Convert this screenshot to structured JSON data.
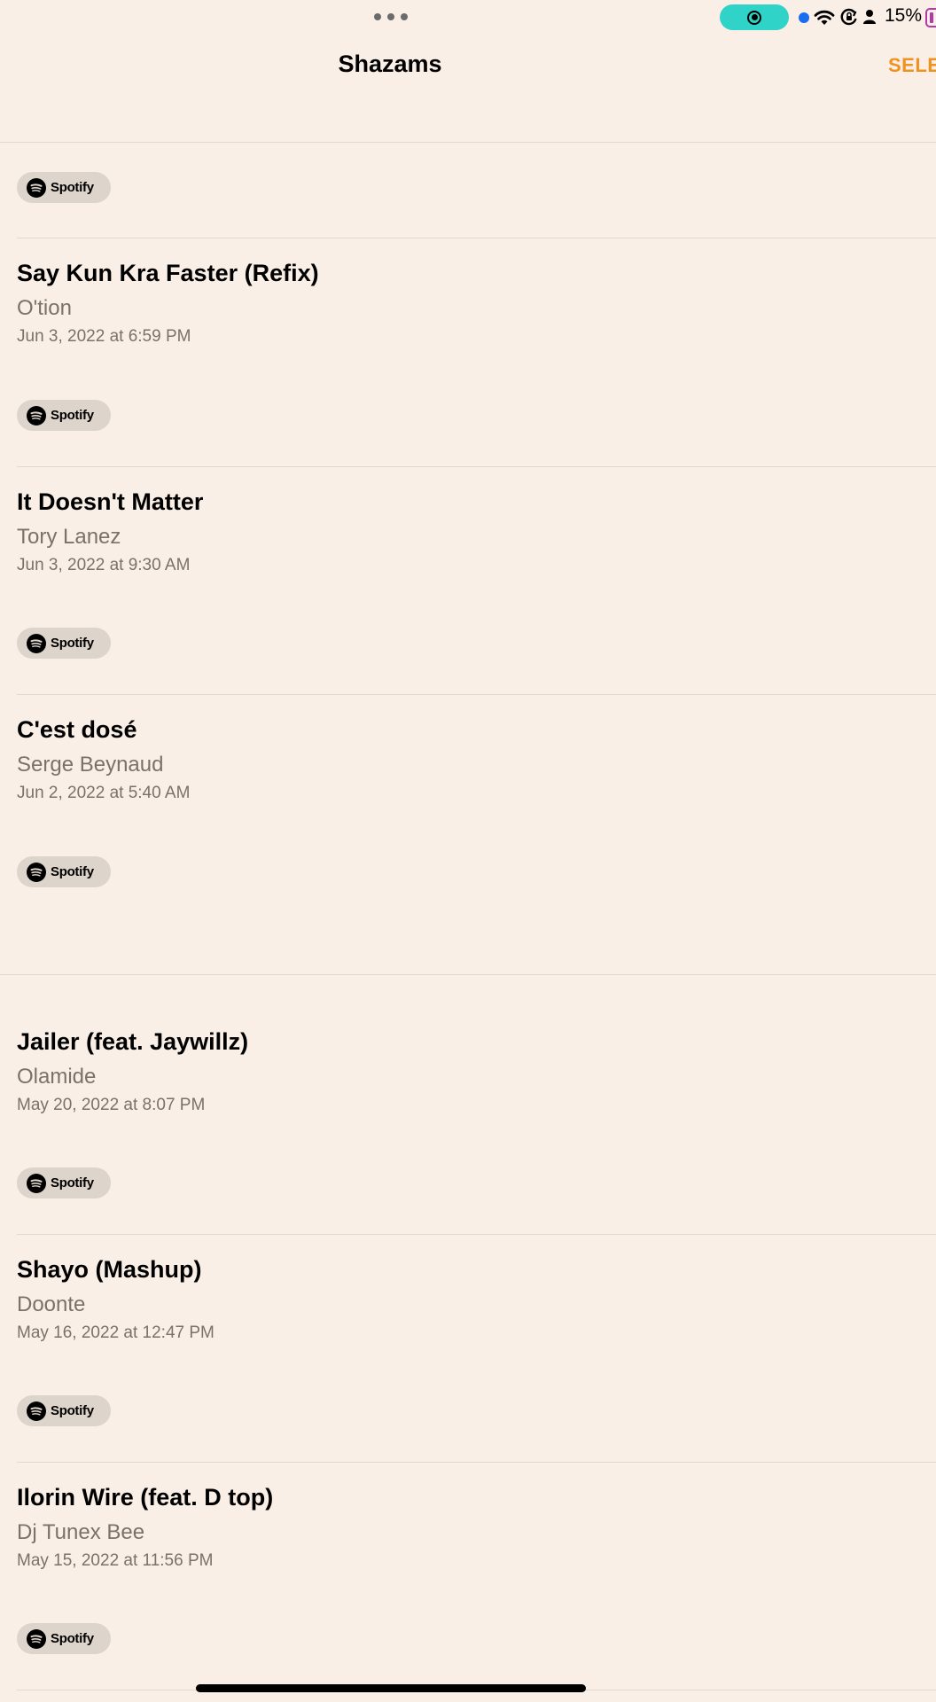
{
  "nav": {
    "title": "Shazams",
    "select_label": "SELE"
  },
  "status_bar": {
    "battery": "15%"
  },
  "spotify_label": "Spotify",
  "items": [
    {
      "title": "Say Kun Kra Faster (Refix)",
      "artist": "O'tion",
      "date": "Jun 3, 2022 at 6:59 PM"
    },
    {
      "title": "It Doesn't Matter",
      "artist": "Tory Lanez",
      "date": "Jun 3, 2022 at 9:30 AM"
    },
    {
      "title": "C'est dosé",
      "artist": "Serge Beynaud",
      "date": "Jun 2, 2022 at 5:40 AM"
    },
    {
      "title": "Jailer (feat. Jaywillz)",
      "artist": "Olamide",
      "date": "May 20, 2022 at 8:07 PM"
    },
    {
      "title": "Shayo (Mashup)",
      "artist": "Doonte",
      "date": "May 16, 2022 at 12:47 PM"
    },
    {
      "title": "Ilorin Wire (feat. D top)",
      "artist": "Dj Tunex Bee",
      "date": "May 15, 2022 at 11:56 PM"
    }
  ]
}
